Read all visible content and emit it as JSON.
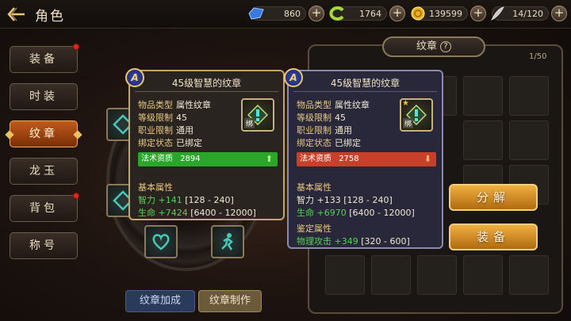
{
  "header": {
    "title": "角色",
    "back_icon": "back-arrow-icon",
    "resources": [
      {
        "name": "gem",
        "icon": "blue-gem-icon",
        "value": "860"
      },
      {
        "name": "scroll",
        "icon": "green-swirl-icon",
        "value": "1764"
      },
      {
        "name": "gold",
        "icon": "gold-coin-icon",
        "value": "139599"
      },
      {
        "name": "stamina",
        "icon": "feather-icon",
        "value": "14/120"
      }
    ]
  },
  "menu": [
    {
      "label": "装备",
      "badge": true
    },
    {
      "label": "时装",
      "badge": false
    },
    {
      "label": "纹章",
      "badge": false,
      "active": true
    },
    {
      "label": "龙玉",
      "badge": false
    },
    {
      "label": "背包",
      "badge": true
    },
    {
      "label": "称号",
      "badge": false
    }
  ],
  "bottom_buttons": {
    "enhance": "纹章加成",
    "craft": "纹章制作"
  },
  "emblem_panel": {
    "tab_label": "纹章",
    "help": "?",
    "count": "1/50"
  },
  "actions": {
    "decompose": "分解",
    "equip": "装备"
  },
  "tooltip_left": {
    "badge": "A",
    "title": "45级智慧的纹章",
    "fields": [
      {
        "k": "物品类型",
        "v": "属性纹章"
      },
      {
        "k": "等级限制",
        "v": "45"
      },
      {
        "k": "职业限制",
        "v": "通用"
      },
      {
        "k": "绑定状态",
        "v": "已绑定"
      }
    ],
    "icon_bind": "绑",
    "stat_bar": {
      "label": "法术资质",
      "value": "2894",
      "direction": "up",
      "color": "#2aa62a"
    },
    "base_title": "基本属性",
    "base_stats": [
      {
        "name": "智力",
        "bonus": "+141",
        "range": "[128 - 240]"
      },
      {
        "name": "生命",
        "bonus": "+7424",
        "range": "[6400 - 12000]"
      }
    ]
  },
  "tooltip_right": {
    "badge": "A",
    "title": "45级智慧的纹章",
    "fields": [
      {
        "k": "物品类型",
        "v": "属性纹章"
      },
      {
        "k": "等级限制",
        "v": "45"
      },
      {
        "k": "职业限制",
        "v": "通用"
      },
      {
        "k": "绑定状态",
        "v": "已绑定"
      }
    ],
    "icon_bind": "绑",
    "stat_bar": {
      "label": "法术资质",
      "value": "2758",
      "direction": "down",
      "color": "#c8402a"
    },
    "base_title": "基本属性",
    "base_stats": [
      {
        "name": "智力",
        "bonus": "+133",
        "range": "[128 - 240]"
      },
      {
        "name": "生命",
        "bonus": "+6970",
        "range": "[6400 - 12000]"
      }
    ],
    "appraise_title": "鉴定属性",
    "appraise_stats": [
      {
        "name": "物理攻击",
        "bonus": "+349",
        "range": "[320 - 600]"
      }
    ]
  }
}
